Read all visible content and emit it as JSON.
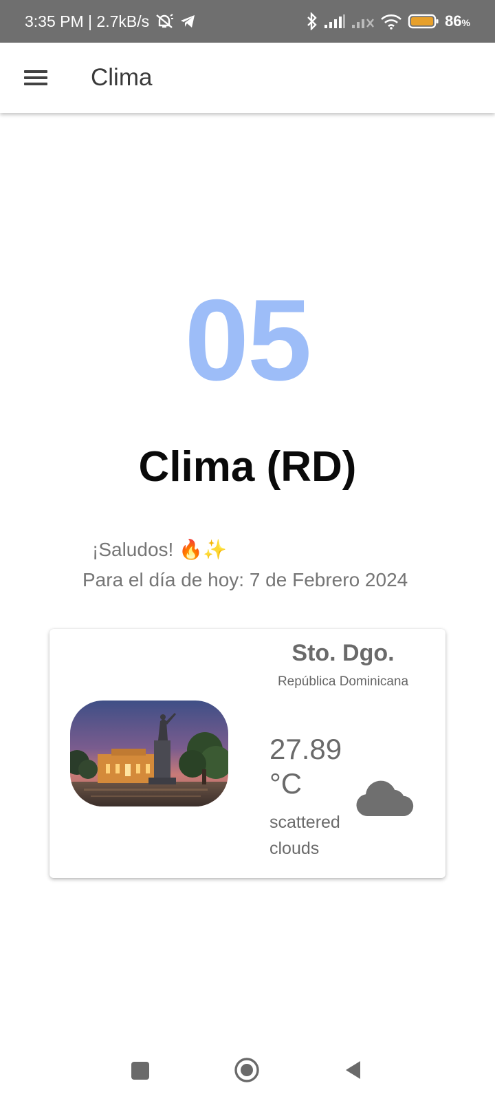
{
  "status_bar": {
    "time_speed": "3:35 PM | 2.7kB/s",
    "battery_percent": "86",
    "battery_unit": "%",
    "icons": [
      "muted-alarm-icon",
      "telegram-icon",
      "bluetooth-icon",
      "signal-icon",
      "no-signal-icon",
      "wifi-icon",
      "battery-icon"
    ],
    "battery_color": "#e7a02b"
  },
  "app_bar": {
    "title": "Clima",
    "menu_icon": "hamburger-menu-icon"
  },
  "main": {
    "big_number": "05",
    "heading": "Clima (RD)",
    "greeting": "¡Saludos!",
    "greeting_emoji": "🔥✨",
    "date_line": "Para el día de hoy: 7 de Febrero 2024",
    "accent_color": "#9dbdf8"
  },
  "weather_card": {
    "city": "Sto. Dgo.",
    "country": "República Dominicana",
    "temperature": "27.89 °C",
    "condition": "scattered clouds",
    "condition_icon": "cloud-icon"
  },
  "nav_bar": {
    "buttons": [
      "recents-square-icon",
      "home-circle-icon",
      "back-triangle-icon"
    ]
  }
}
